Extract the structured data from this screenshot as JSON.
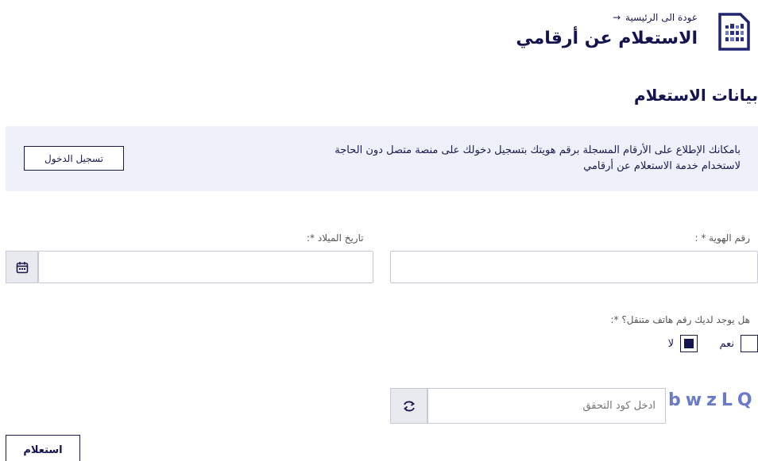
{
  "header": {
    "back_label": "عودة الى الرئيسية",
    "title": "الاستعلام عن أرقامي",
    "logo_icon": "sim-card-icon",
    "back_icon": "arrow-right-icon"
  },
  "section": {
    "title": "بيانات الاستعلام"
  },
  "info": {
    "text": "بامكانك الإطلاع على الأرقام المسجلة برقم هويتك بتسجيل دخولك على منصة متصل دون الحاجة لاستخدام خدمة الاستعلام عن أرقامي",
    "login_label": "تسجيل الدخول"
  },
  "form": {
    "id_label": "رقم الهوية * :",
    "id_value": "",
    "dob_label": "تاريخ الميلاد *:",
    "dob_value": "",
    "calendar_icon": "calendar-icon",
    "phone_question": "هل يوجد لديك رقم هاتف متنقل؟ *:",
    "options": [
      {
        "label": "نعم",
        "checked": false
      },
      {
        "label": "لا",
        "checked": true
      }
    ]
  },
  "captcha": {
    "code": "bwzLQ",
    "placeholder": "ادخل كود التحقق",
    "refresh_icon": "refresh-icon"
  },
  "submit_label": "استعلام",
  "colors": {
    "primary": "#141451",
    "info_bg": "#eef1f9",
    "captcha_text": "#6a7ac8",
    "border": "#c6c9d4"
  }
}
